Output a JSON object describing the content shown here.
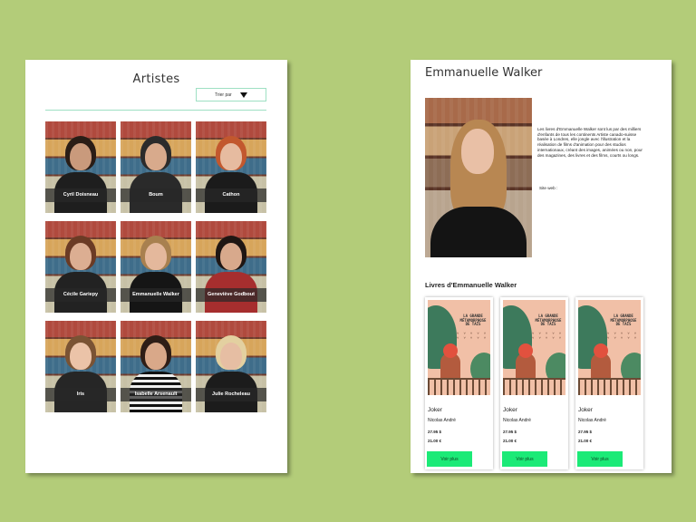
{
  "colors": {
    "background": "#b3cc79",
    "accent_line": "#9ee0c3",
    "button": "#1bea77"
  },
  "artists_page": {
    "title": "Artistes",
    "sort": {
      "label": "Trier par",
      "icon": "triangle-down-icon"
    },
    "artists": [
      {
        "name": "Cyril Doisneau"
      },
      {
        "name": "Boum"
      },
      {
        "name": "Cathon"
      },
      {
        "name": "Cécile Gariepy"
      },
      {
        "name": "Emmanuelle Walker"
      },
      {
        "name": "Geneviève Godbout"
      },
      {
        "name": "Iris"
      },
      {
        "name": "Isabelle Arsenault"
      },
      {
        "name": "Julie Rocheleau"
      }
    ]
  },
  "artist_page": {
    "name": "Emmanuelle Walker",
    "bio": "Les livres d'Emmanuelle Walker sont lus par des milliers d'enfants de tous les continents Artiste canado-suisse basée à Londres, elle jongle avec l'illustration et la réalisation de films d'animation pour des studios internationaux, créant des images, animées ou non, pour des magazines, des livres et des films, courts ou longs.",
    "website_label": "Site web :",
    "books_title": "Livres d'Emmanuelle Walker",
    "books": [
      {
        "cover_title": "LA GRANDE MÉTAMORPHOSE DE TAÏS",
        "title": "Joker",
        "author": "Nicolas André",
        "price_old": "27.95 $",
        "price_new": "21.00 €",
        "button": "Voir plus"
      },
      {
        "cover_title": "LA GRANDE MÉTAMORPHOSE DE TAÏS",
        "title": "Joker",
        "author": "Nicolas André",
        "price_old": "27.95 $",
        "price_new": "21.00 €",
        "button": "Voir plus"
      },
      {
        "cover_title": "LA GRANDE MÉTAMORPHOSE DE TAÏS",
        "title": "Joker",
        "author": "Nicolas André",
        "price_old": "27.95 $",
        "price_new": "21.00 €",
        "button": "Voir plus"
      }
    ]
  }
}
